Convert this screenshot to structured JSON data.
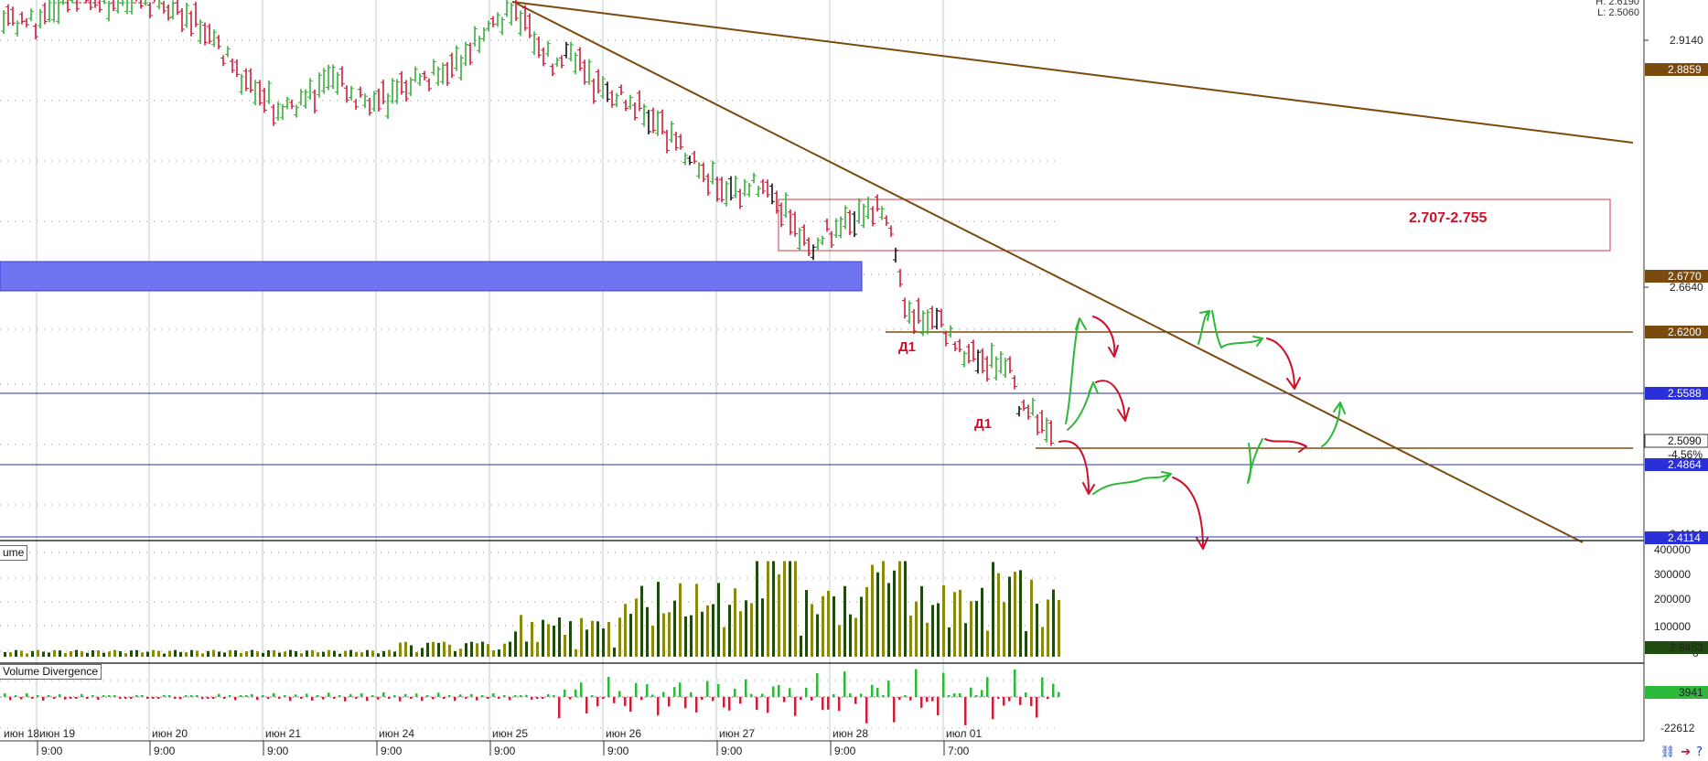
{
  "header": {
    "high_label": "H: 2.6190",
    "low_label": "L: 2.5060"
  },
  "colors": {
    "bull": "#3cae3c",
    "bear": "#cc1f3a",
    "trendline": "#7a4a0e",
    "blue_line": "#2b2fb8",
    "zone_fill": "#6f74f0",
    "box": "#d63a4a",
    "annot_red": "#d0102a",
    "annot_green": "#2cb838",
    "vol_dark": "#1f4a10",
    "vol_olive": "#8a8a10"
  },
  "price_axis": {
    "labels": [
      "2.9140",
      "2.6640",
      "2.4114"
    ],
    "tags": [
      {
        "label": "2.8859",
        "style": "brown"
      },
      {
        "label": "2.6770",
        "style": "brown"
      },
      {
        "label": "2.6200",
        "style": "brown"
      },
      {
        "label": "2.5588",
        "style": "blue"
      },
      {
        "label": "2.5090",
        "style": "white"
      },
      {
        "label": "-4.56%",
        "style": "plain"
      },
      {
        "label": "2.4864",
        "style": "blue"
      },
      {
        "label": "2.4114",
        "style": "blue"
      }
    ]
  },
  "volume_axis": {
    "labels": [
      "400000",
      "300000",
      "200000",
      "100000",
      "0"
    ],
    "tag": "2.8453"
  },
  "divergence_axis": {
    "labels": [
      "-22612"
    ],
    "tag": "3941"
  },
  "panels": {
    "volume_label": "ume",
    "divergence_label": "Volume Divergence"
  },
  "time_axis": {
    "dates": [
      "июн 18",
      "июн 19",
      "июн 20",
      "июн 21",
      "июн 24",
      "июн 25",
      "июн 26",
      "июн 27",
      "июн 28",
      "июл 01"
    ],
    "times": [
      "9:00",
      "9:00",
      "9:00",
      "9:00",
      "9:00",
      "9:00",
      "9:00",
      "9:00",
      "7:00"
    ]
  },
  "annotations": {
    "box_label": "2.707-2.755",
    "d1_upper": "Д1",
    "d1_lower": "Д1"
  },
  "icons": {
    "link": "link-icon",
    "exit": "exit-icon",
    "help": "help-icon"
  }
}
